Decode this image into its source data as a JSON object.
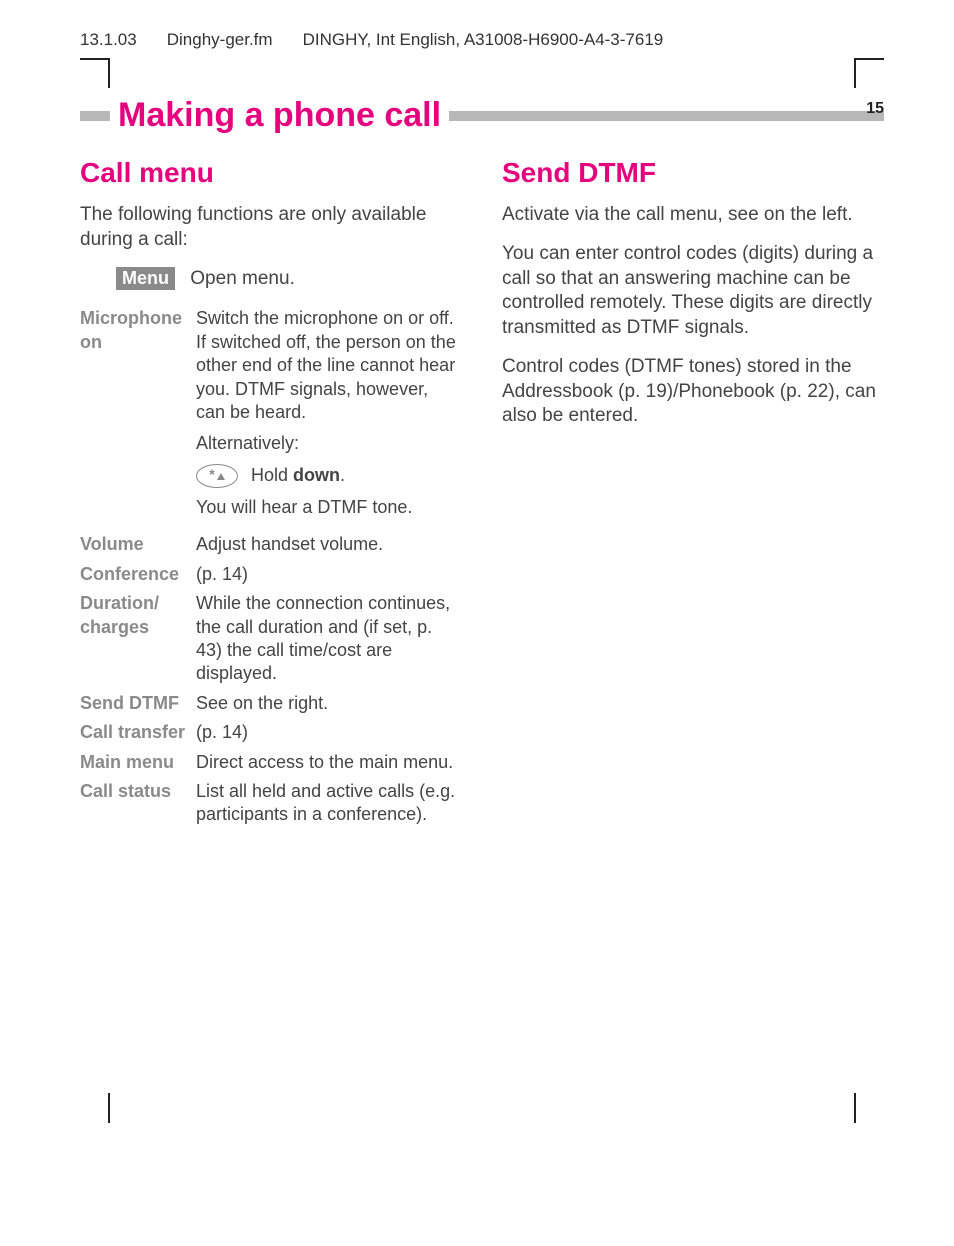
{
  "header": {
    "date": "13.1.03",
    "file": "Dinghy-ger.fm",
    "doc": "DINGHY, Int English, A31008-H6900-A4-3-7619"
  },
  "page": {
    "title": "Making a phone call",
    "number": "15"
  },
  "left": {
    "heading": "Call menu",
    "intro": "The following functions are only available during a call:",
    "menu_key": "Menu",
    "open_menu": "Open menu.",
    "rows": {
      "microphone": {
        "label": "Microphone on",
        "desc1": "Switch the microphone on or off. If switched off, the person on the other end of the line cannot hear you. DTMF signals, however, can be heard.",
        "alt": "Alternatively:",
        "hold_pre": "Hold ",
        "hold_bold": "down",
        "hold_post": ".",
        "tone": "You will hear a DTMF tone."
      },
      "volume": {
        "label": "Volume",
        "desc": "Adjust handset volume."
      },
      "conference": {
        "label": "Conference",
        "desc": "(p. 14)"
      },
      "duration": {
        "label": "Duration/ charges",
        "desc": "While the connection continues, the call duration and (if set, p. 43) the call time/cost are displayed."
      },
      "send_dtmf": {
        "label": "Send DTMF",
        "desc": "See on the right."
      },
      "transfer": {
        "label": "Call transfer",
        "desc": "(p. 14)"
      },
      "main_menu": {
        "label": "Main menu",
        "desc": "Direct access to the main menu."
      },
      "call_status": {
        "label": "Call status",
        "desc": "List all held and active calls (e.g. participants in a conference)."
      }
    }
  },
  "right": {
    "heading": "Send DTMF",
    "p1": "Activate via the call menu, see on the left.",
    "p2": "You can enter control codes (digits) during a call so that an answering machine can be controlled remotely. These digits are directly transmitted as DTMF signals.",
    "p3": "Control codes (DTMF tones) stored in the Addressbook (p. 19)/Phonebook (p. 22), can also be entered."
  }
}
